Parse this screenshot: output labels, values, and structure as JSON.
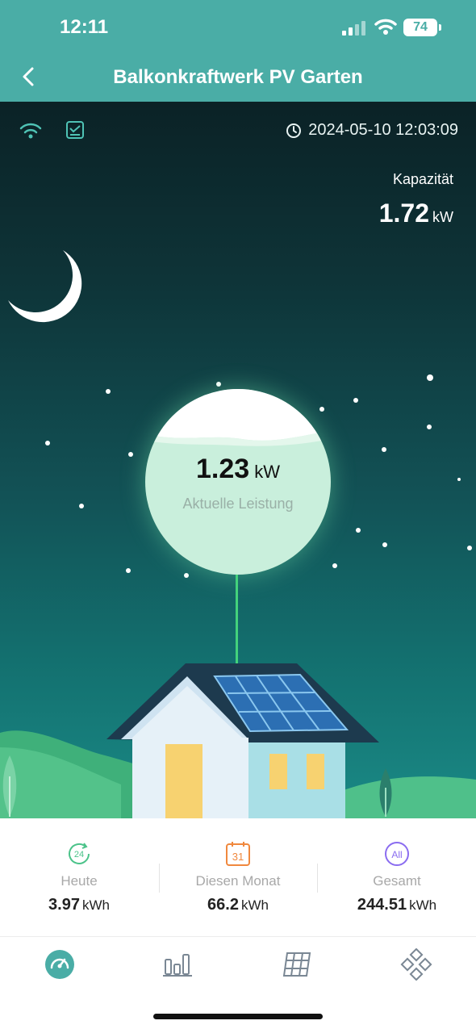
{
  "status_bar": {
    "time": "12:11",
    "battery": "74"
  },
  "header": {
    "title": "Balkonkraftwerk PV Garten"
  },
  "scene": {
    "datetime": "2024-05-10 12:03:09",
    "capacity_label": "Kapazität",
    "capacity_value": "1.72",
    "capacity_unit": "kW",
    "power_value": "1.23",
    "power_unit": "kW",
    "power_label": "Aktuelle Leistung"
  },
  "stats": [
    {
      "icon_text": "24",
      "label": "Heute",
      "value": "3.97",
      "unit": "kWh",
      "color": "#4cc38a"
    },
    {
      "icon_text": "31",
      "label": "Diesen Monat",
      "value": "66.2",
      "unit": "kWh",
      "color": "#f0883e"
    },
    {
      "icon_text": "All",
      "label": "Gesamt",
      "value": "244.51",
      "unit": "kWh",
      "color": "#8a6cf0"
    }
  ],
  "nav": {
    "items": [
      "dashboard-icon",
      "bar-chart-icon",
      "solar-panel-icon",
      "devices-icon"
    ],
    "active": "dashboard-icon",
    "accent": "#4aada6"
  }
}
